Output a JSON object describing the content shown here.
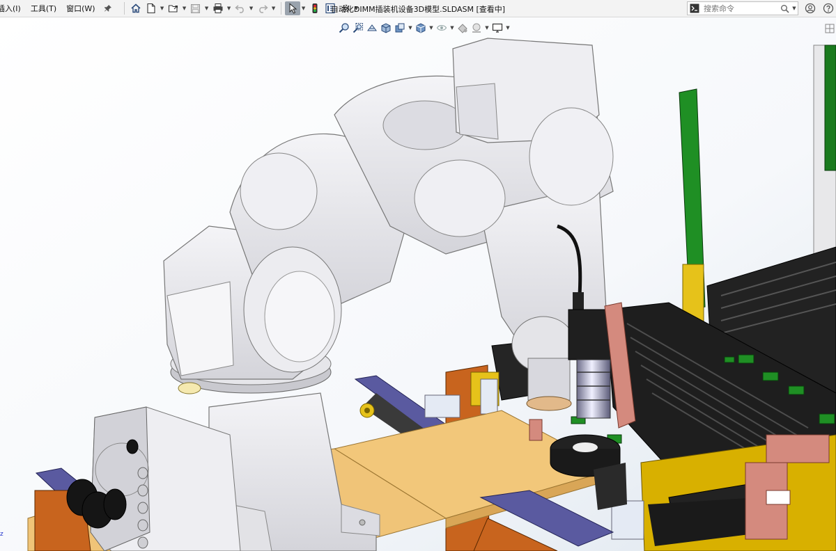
{
  "menu": {
    "items": [
      {
        "label": "插入(I)"
      },
      {
        "label": "工具(T)"
      },
      {
        "label": "窗口(W)"
      }
    ]
  },
  "window": {
    "title": "自动化DIMM插装机设备3D模型.SLDASM [查看中]"
  },
  "search": {
    "placeholder": "搜索命令"
  },
  "colors": {
    "robot": "#e8e8ec",
    "plate": "#f2c77a",
    "green": "#1c8a22",
    "black": "#1b1b1b",
    "orange": "#c8641e",
    "salmon": "#d48a7e",
    "yellow": "#e6c21a",
    "purple": "#5a5aa0",
    "background": "#ffffff"
  },
  "triad": {
    "z_label": "z"
  }
}
